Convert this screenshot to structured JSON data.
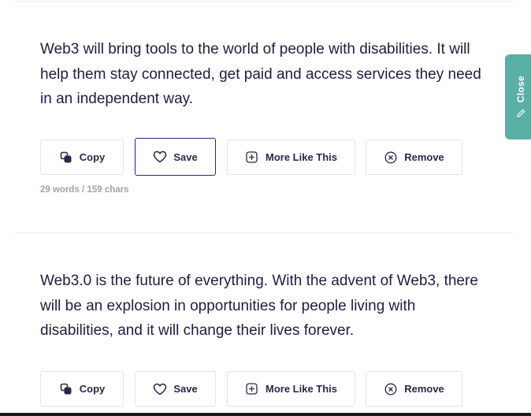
{
  "close_tab": {
    "label": "Close"
  },
  "cards": [
    {
      "text": "Web3 will bring tools to the world of people with disabilities. It will help them stay connected, get paid and access services they need in an independent way.",
      "buttons": {
        "copy": "Copy",
        "save": "Save",
        "more": "More Like This",
        "remove": "Remove"
      },
      "stats": "29 words / 159 chars"
    },
    {
      "text": "Web3.0 is the future of everything. With the advent of Web3, there will be an explosion in opportunities for people living with disabilities, and it will change their lives forever.",
      "buttons": {
        "copy": "Copy",
        "save": "Save",
        "more": "More Like This",
        "remove": "Remove"
      }
    }
  ],
  "colors": {
    "accent_teal": "#5aafa7",
    "save_active_border": "#23297a",
    "text": "#1c1f3f"
  }
}
